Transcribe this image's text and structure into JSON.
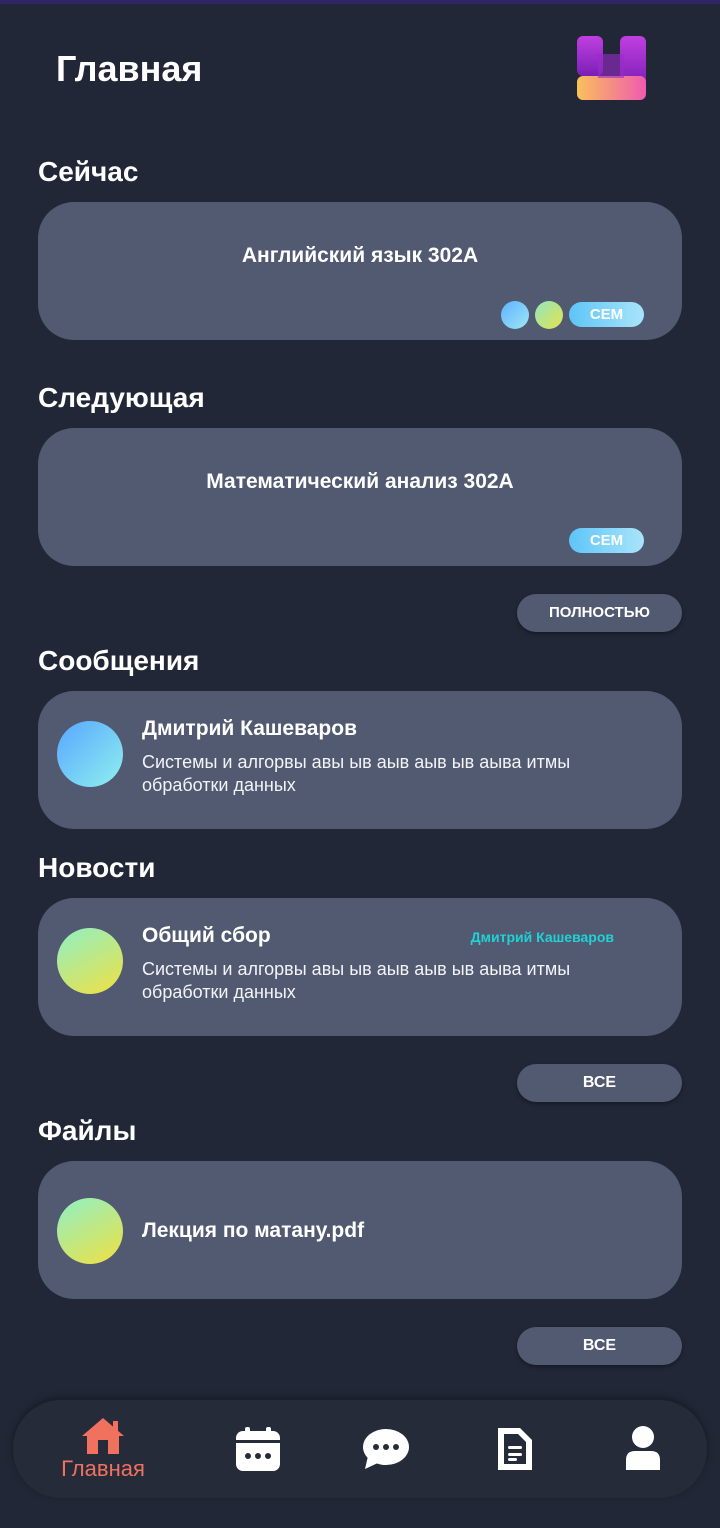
{
  "header": {
    "title": "Главная",
    "logo": "app-logo"
  },
  "now": {
    "section_title": "Сейчас",
    "lesson": "Английский язык 302А",
    "tag": "СЕМ",
    "dot_colors": [
      "#5fb2ff",
      "#e6e24a"
    ]
  },
  "next": {
    "section_title": "Следующая",
    "lesson": "Математический анализ 302А",
    "tag": "СЕМ",
    "button": "ПОЛНОСТЬЮ"
  },
  "messages": {
    "section_title": "Сообщения",
    "items": [
      {
        "sender": "Дмитрий Кашеваров",
        "text": "Системы и алгорвы авы ыв аыв аыв ыв аыва итмы обработки данных"
      }
    ]
  },
  "news": {
    "section_title": "Новости",
    "items": [
      {
        "title": "Общий сбор",
        "author": "Дмитрий Кашеваров",
        "text": "Системы и алгорвы авы ыв аыв аыв ыв аыва итмы обработки данных"
      }
    ],
    "button": "ВСЕ"
  },
  "files": {
    "section_title": "Файлы",
    "items": [
      {
        "name": "Лекция по матану.pdf"
      }
    ],
    "button": "ВСЕ"
  },
  "nav": {
    "items": [
      {
        "icon": "home-icon",
        "label": "Главная",
        "active": true
      },
      {
        "icon": "calendar-icon",
        "label": ""
      },
      {
        "icon": "chat-icon",
        "label": ""
      },
      {
        "icon": "file-icon",
        "label": ""
      },
      {
        "icon": "profile-icon",
        "label": ""
      }
    ]
  },
  "colors": {
    "background": "#222737",
    "card": "#515a70",
    "accent": "#f0725e",
    "author": "#1fd2d6"
  }
}
